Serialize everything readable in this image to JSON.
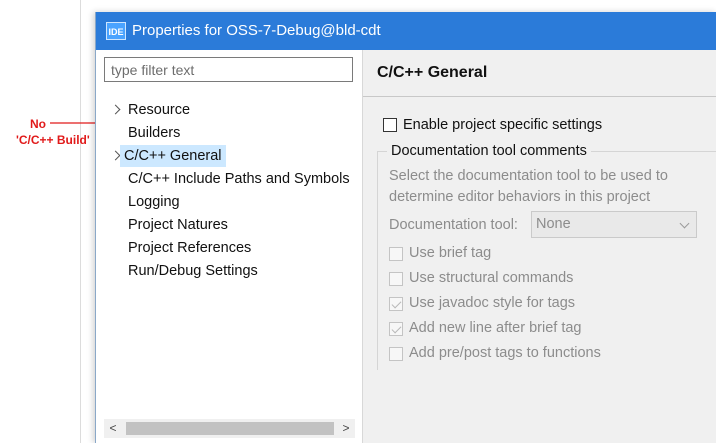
{
  "annotation": {
    "line1": "No",
    "line2": "'C/C++ Build'",
    "color": "#e11a1a"
  },
  "window": {
    "title": "Properties for OSS-7-Debug@bld-cdt",
    "icon_text": "IDE",
    "titlebar_color": "#2b7bd9"
  },
  "filter": {
    "placeholder": "type filter text",
    "value": ""
  },
  "tree": {
    "items": [
      {
        "label": "Resource",
        "expandable": true
      },
      {
        "label": "Builders",
        "expandable": false
      },
      {
        "label": "C/C++ General",
        "expandable": true,
        "selected": true
      },
      {
        "label": "C/C++ Include Paths and Symbols",
        "expandable": false
      },
      {
        "label": "Logging",
        "expandable": false
      },
      {
        "label": "Project Natures",
        "expandable": false
      },
      {
        "label": "Project References",
        "expandable": false
      },
      {
        "label": "Run/Debug Settings",
        "expandable": false
      }
    ]
  },
  "scrollbar": {
    "left_arrow": "<",
    "right_arrow": ">"
  },
  "page": {
    "title": "C/C++ General",
    "enable_label": "Enable project specific settings",
    "group_title": "Documentation tool comments",
    "description": "Select the documentation tool to be used to determine editor behaviors in this project",
    "doc_tool_label": "Documentation tool:",
    "doc_tool_value": "None",
    "options": [
      {
        "label": "Use brief tag",
        "checked": false
      },
      {
        "label": "Use structural commands",
        "checked": false
      },
      {
        "label": "Use javadoc style for tags",
        "checked": true
      },
      {
        "label": "Add new line after brief tag",
        "checked": true
      },
      {
        "label": "Add pre/post tags to functions",
        "checked": false
      }
    ]
  }
}
